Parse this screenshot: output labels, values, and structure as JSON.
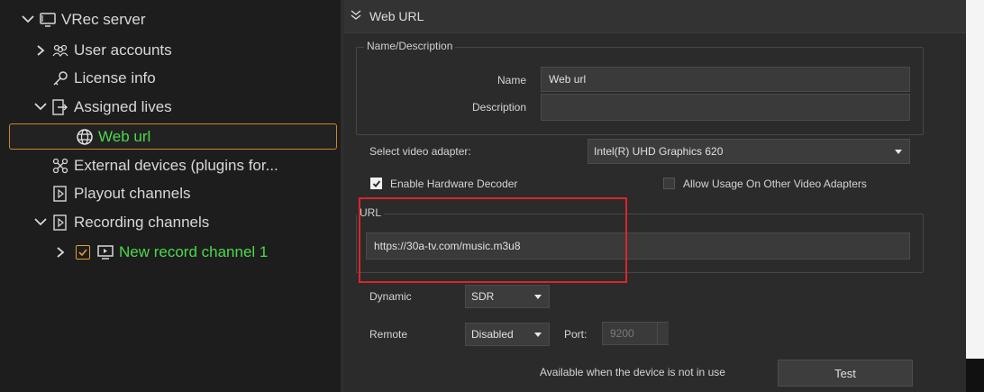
{
  "tree": {
    "root": "VRec server",
    "user_accounts": "User accounts",
    "license_info": "License info",
    "assigned_lives": "Assigned lives",
    "web_url": "Web url",
    "external_devices": "External devices (plugins for...",
    "playout_channels": "Playout channels",
    "recording_channels": "Recording channels",
    "new_record_channel": "New record channel 1"
  },
  "panel": {
    "header_title": "Web URL",
    "name_description_group": "Name/Description",
    "name_label": "Name",
    "name_value": "Web url",
    "description_label": "Description",
    "description_value": "",
    "video_adapter_label": "Select video adapter:",
    "video_adapter_value": "Intel(R) UHD Graphics 620",
    "enable_hw_decoder_label": "Enable Hardware Decoder",
    "enable_hw_decoder_checked": true,
    "allow_other_adapters_label": "Allow Usage On Other Video Adapters",
    "allow_other_adapters_checked": false,
    "url_group": "URL",
    "url_value": "https://30a-tv.com/music.m3u8",
    "dynamic_label": "Dynamic",
    "dynamic_value": "SDR",
    "remote_label": "Remote",
    "remote_value": "Disabled",
    "port_label": "Port:",
    "port_value": "9200",
    "availability_note": "Available when the device is not in use",
    "test_button": "Test"
  },
  "colors": {
    "selection_border": "#c8872a",
    "green_text": "#4cd94c",
    "highlight_red": "#d9252e"
  },
  "icons": [
    "chevron-down-icon",
    "monitor-icon",
    "chevron-right-icon",
    "users-icon",
    "key-icon",
    "assign-icon",
    "globe-icon",
    "plugin-icon",
    "document-icon",
    "checkbox-icon",
    "screen-icon"
  ]
}
